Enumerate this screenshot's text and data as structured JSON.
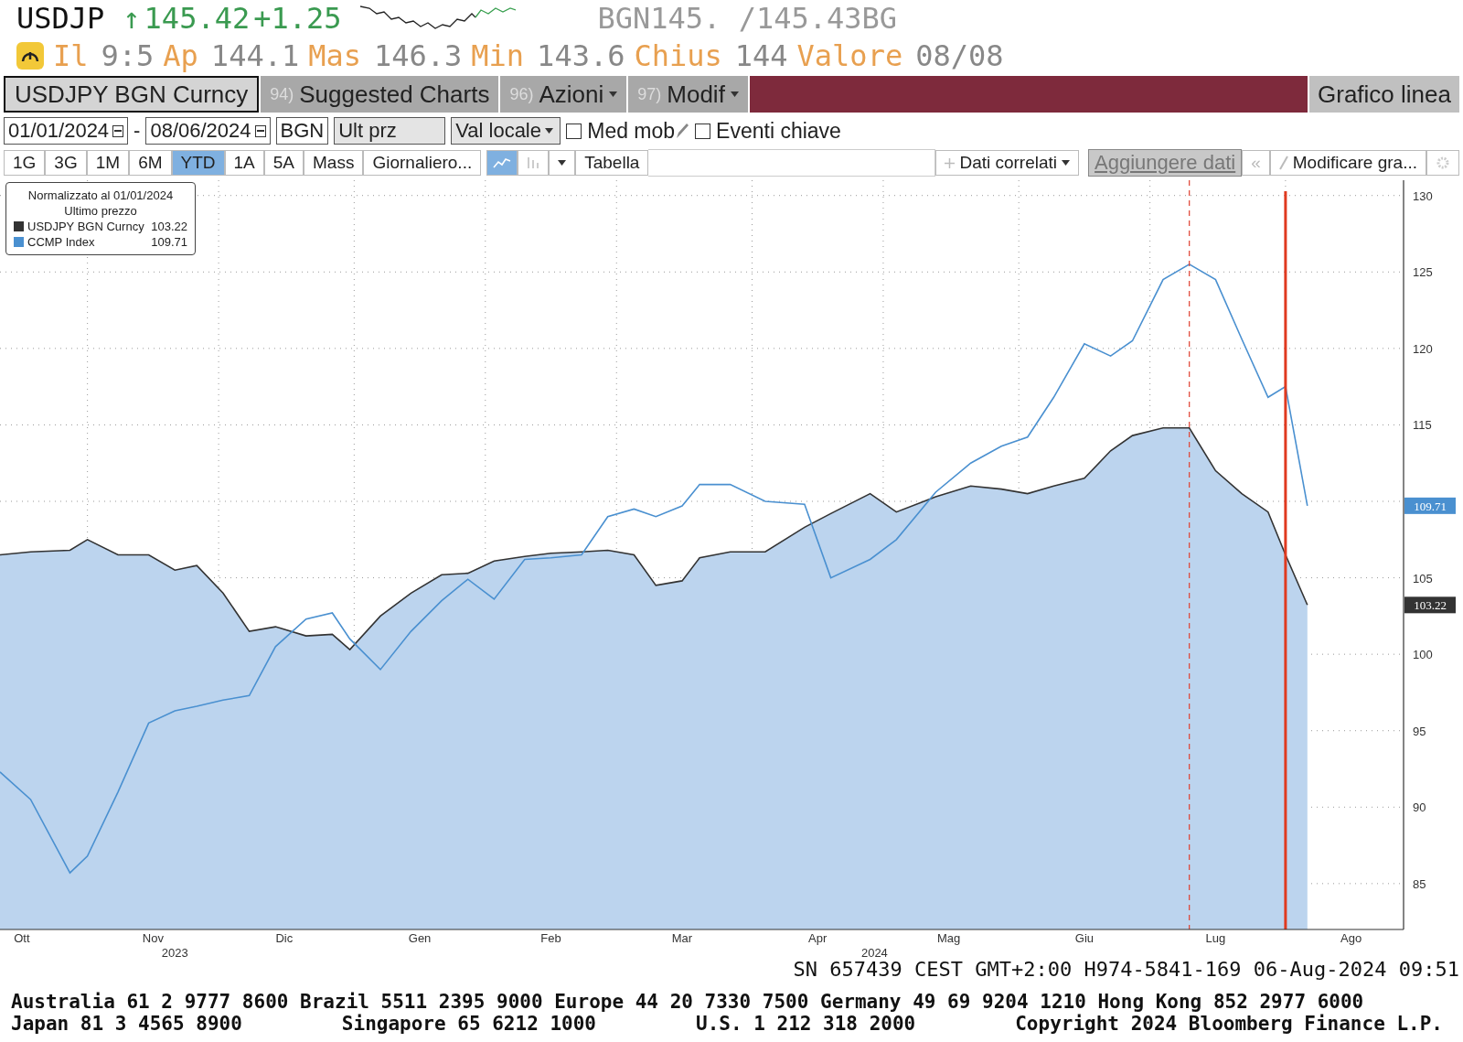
{
  "quote": {
    "ticker": "USDJP",
    "arrow": "↑",
    "price": "145.42",
    "change": "+1.25",
    "bid_ask": "BGN145. /145.43BG"
  },
  "stats": [
    {
      "label": "Il",
      "value": "9:5"
    },
    {
      "label": "Ap",
      "value": "144.1"
    },
    {
      "label": "Mas",
      "value": "146.3"
    },
    {
      "label": "Min",
      "value": "143.6"
    },
    {
      "label": "Chius",
      "value": "144"
    },
    {
      "label": "Valore",
      "value": "08/08"
    }
  ],
  "toolbar": {
    "security": "USDJPY BGN Curncy",
    "menus": [
      {
        "number": "94)",
        "label": "Suggested Charts",
        "dropdown": false
      },
      {
        "number": "96)",
        "label": "Azioni",
        "dropdown": true
      },
      {
        "number": "97)",
        "label": "Modif",
        "dropdown": true
      }
    ],
    "chart_type": "Grafico linea"
  },
  "range": {
    "start": "01/01/2024",
    "separator": "-",
    "end": "08/06/2024",
    "source": "BGN",
    "field": "Ult prz",
    "currency": "Val locale",
    "options": [
      {
        "label": "Med mob",
        "checked": false,
        "editable": true
      },
      {
        "label": "Eventi chiave",
        "checked": false,
        "editable": false
      }
    ]
  },
  "periods": [
    {
      "label": "1G",
      "selected": false
    },
    {
      "label": "3G",
      "selected": false
    },
    {
      "label": "1M",
      "selected": false
    },
    {
      "label": "6M",
      "selected": false
    },
    {
      "label": "YTD",
      "selected": true
    },
    {
      "label": "1A",
      "selected": false
    },
    {
      "label": "5A",
      "selected": false
    },
    {
      "label": "Mass",
      "selected": false
    }
  ],
  "frequency": "Giornaliero...",
  "view_modes": [
    {
      "kind": "line",
      "selected": true
    },
    {
      "kind": "bar",
      "selected": false
    }
  ],
  "table_button": "Tabella",
  "related": "Dati correlati",
  "add_data": "Aggiungere dati",
  "collapse": "«",
  "edit_chart": "Modificare gra...",
  "chart": {
    "legend": {
      "title": "Normalizzato al 01/01/2024",
      "subtitle": "Ultimo prezzo",
      "values": [
        "103.22",
        "109.71"
      ]
    },
    "year_labels": [
      "2023",
      "2024"
    ],
    "chart_data": {
      "type": "line",
      "grid": true,
      "ref_lines": [
        {
          "axis": "x",
          "value": "2024-07-10",
          "color": "#e04030"
        },
        {
          "axis": "x",
          "value": "2024-08-01",
          "color": "#e03a20"
        }
      ],
      "x": [
        "2023-10-12",
        "2023-10-19",
        "2023-10-28",
        "2023-11-01",
        "2023-11-08",
        "2023-11-15",
        "2023-11-21",
        "2023-11-26",
        "2023-12-02",
        "2023-12-08",
        "2023-12-14",
        "2023-12-21",
        "2023-12-27",
        "2023-12-31",
        "2024-01-07",
        "2024-01-14",
        "2024-01-21",
        "2024-01-27",
        "2024-02-02",
        "2024-02-09",
        "2024-02-15",
        "2024-02-22",
        "2024-02-28",
        "2024-03-05",
        "2024-03-10",
        "2024-03-16",
        "2024-03-20",
        "2024-03-27",
        "2024-04-04",
        "2024-04-13",
        "2024-04-19",
        "2024-04-28",
        "2024-05-04",
        "2024-05-13",
        "2024-05-21",
        "2024-05-28",
        "2024-06-03",
        "2024-06-09",
        "2024-06-16",
        "2024-06-22",
        "2024-06-27",
        "2024-07-04",
        "2024-07-10",
        "2024-07-16",
        "2024-07-22",
        "2024-07-28",
        "2024-08-01",
        "2024-08-06"
      ],
      "series": [
        {
          "name": "USDJPY BGN Curncy",
          "color": "#333333",
          "type": "area",
          "values": [
            106.5,
            106.7,
            106.8,
            107.5,
            106.5,
            106.5,
            105.5,
            105.8,
            104,
            101.5,
            101.8,
            101.2,
            101.3,
            100.3,
            102.5,
            104,
            105.2,
            105.3,
            106.1,
            106.4,
            106.6,
            106.7,
            106.8,
            106.5,
            104.5,
            104.8,
            106.3,
            106.7,
            106.7,
            108.3,
            109.2,
            110.5,
            109.3,
            110.3,
            111,
            110.8,
            110.5,
            111,
            111.5,
            113.3,
            114.3,
            114.8,
            114.8,
            112,
            110.5,
            109.3,
            106.5,
            103.22
          ]
        },
        {
          "name": "CCMP Index",
          "color": "#4a90d0",
          "type": "line",
          "values": [
            92.3,
            90.5,
            85.7,
            86.8,
            91,
            95.5,
            96.3,
            96.6,
            97,
            97.3,
            100.5,
            102.3,
            102.7,
            101,
            99,
            101.5,
            103.5,
            104.9,
            103.6,
            106.2,
            106.3,
            106.5,
            109,
            109.5,
            109,
            109.7,
            111.1,
            111.1,
            110,
            109.8,
            105,
            106.2,
            107.5,
            110.6,
            112.5,
            113.6,
            114.2,
            116.8,
            120.3,
            119.5,
            120.5,
            124.5,
            125.5,
            124.5,
            120.6,
            116.8,
            117.5,
            109.71
          ]
        }
      ],
      "xlim": [
        "2023-10-12",
        "2024-08-28"
      ],
      "ylim": [
        82,
        131
      ],
      "xticks": [
        {
          "value": "2023-10-17",
          "label": "Ott"
        },
        {
          "value": "2023-11-16",
          "label": "Nov"
        },
        {
          "value": "2023-12-16",
          "label": "Dic"
        },
        {
          "value": "2024-01-16",
          "label": "Gen"
        },
        {
          "value": "2024-02-15",
          "label": "Feb"
        },
        {
          "value": "2024-03-16",
          "label": "Mar"
        },
        {
          "value": "2024-04-16",
          "label": "Apr"
        },
        {
          "value": "2024-05-16",
          "label": "Mag"
        },
        {
          "value": "2024-06-16",
          "label": "Giu"
        },
        {
          "value": "2024-07-16",
          "label": "Lug"
        },
        {
          "value": "2024-08-16",
          "label": "Ago"
        }
      ],
      "yticks": [
        85,
        90,
        95,
        100,
        105,
        115,
        120,
        125,
        130
      ],
      "annotations": [
        "103.22",
        "109.71"
      ]
    }
  },
  "footer": {
    "session": "SN 657439 CEST GMT+2:00 H974-5841-169 06-Aug-2024 09:51",
    "lines": [
      [
        "Australia 61 2 9777 8600 Brazil 5511 2395 9000 Europe 44 20 7330 7500 Germany 49 69 9204 1210 Hong Kong 852 2977 6000"
      ],
      [
        "Japan 81 3 4565 8900",
        "Singapore 65 6212 1000",
        "U.S. 1 212 318 2000",
        "Copyright 2024 Bloomberg Finance L.P."
      ]
    ]
  }
}
